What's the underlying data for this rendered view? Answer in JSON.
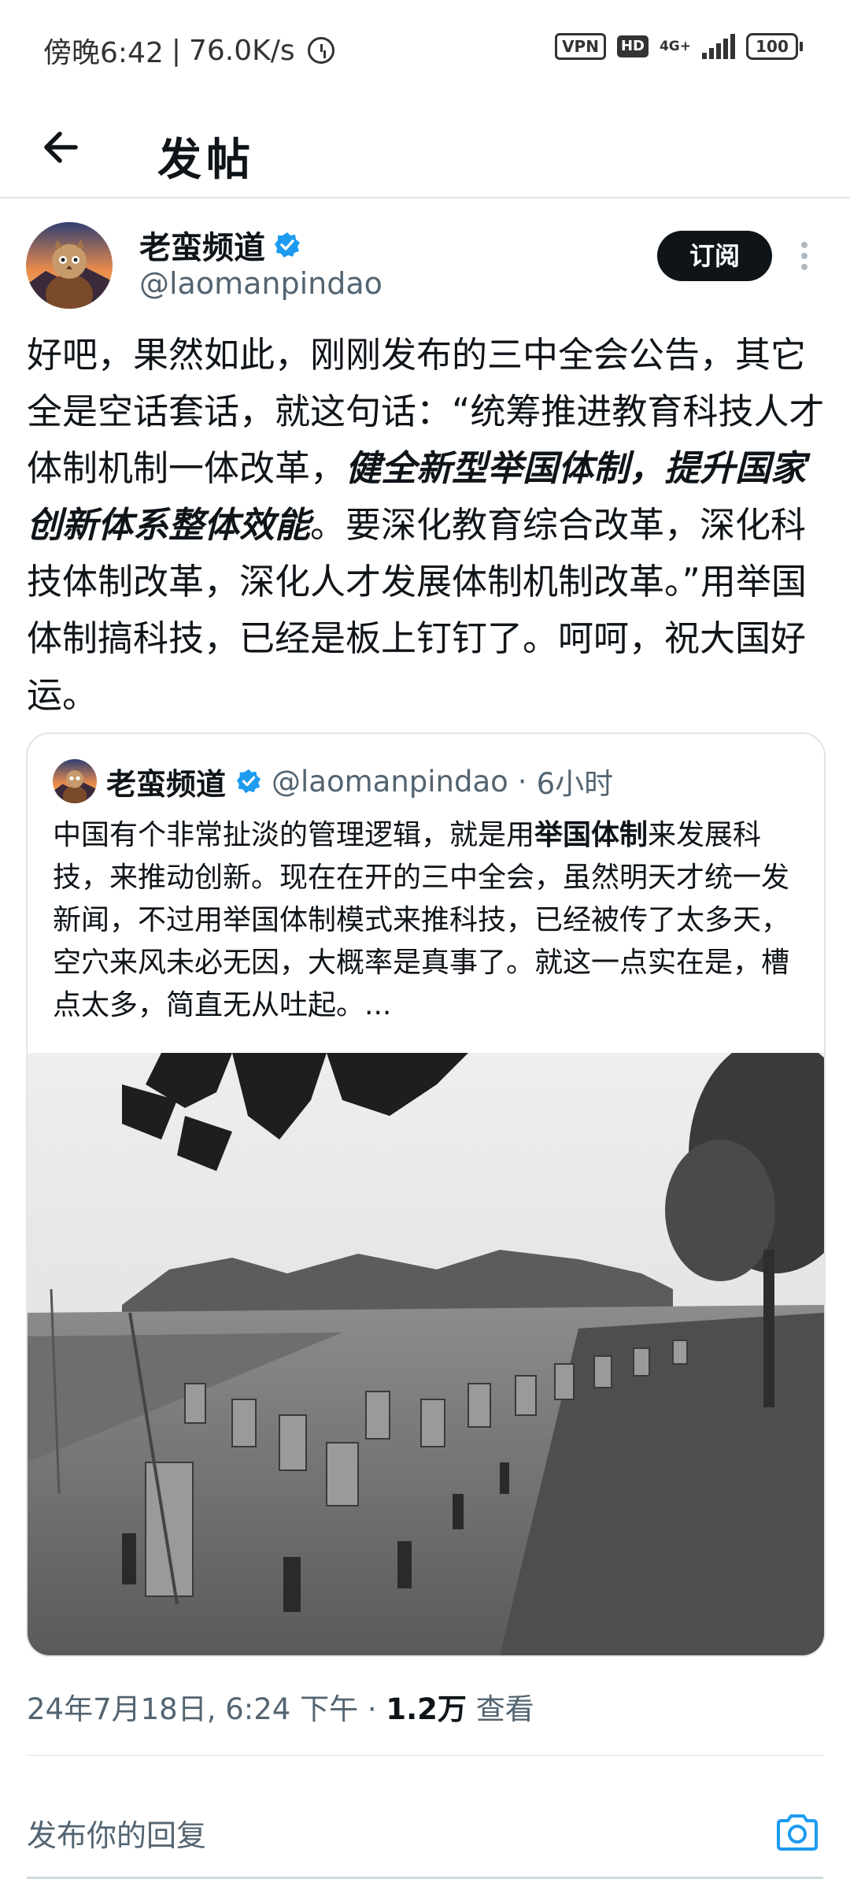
{
  "status_bar": {
    "time": "傍晚6:42",
    "speed": "76.0K/s",
    "vpn": "VPN",
    "hd": "HD",
    "network": "4G+",
    "battery": "100"
  },
  "header": {
    "title": "发帖"
  },
  "post": {
    "author_name": "老蛮频道",
    "author_handle": "@laomanpindao",
    "subscribe_label": "订阅",
    "text_1": "好吧，果然如此，刚刚发布的三中全会公告，其它全是空话套话，就这句话：“统筹推进教育科技人才体制机制一体改革，",
    "text_emph": "健全新型举国体制，提升国家创新体系整体效能",
    "text_2": "。要深化教育综合改革，深化科技体制改革，深化人才发展体制机制改革。”用举国体制搞科技，已经是板上钉钉了。呵呵，祝大国好运。",
    "timestamp": "24年7月18日, 6:24 下午",
    "views_count": "1.2万",
    "views_label": "查看"
  },
  "quote": {
    "author_name": "老蛮频道",
    "author_handle": "@laomanpindao",
    "time": "6小时",
    "text_1": "中国有个非常扯淡的管理逻辑，就是用",
    "text_bold": "举国体制",
    "text_2": "来发展科技，来推动创新。现在在开的三中全会，虽然明天才统一发新闻，不过用举国体制模式来推科技，已经被传了太多天，空穴来风未必无因，大概率是真事了。就这一点实在是，槽点太多，简直无从吐起。..."
  },
  "reply": {
    "placeholder": "发布你的回复"
  },
  "colors": {
    "verified": "#1d9bf0",
    "text_primary": "#0f1419",
    "text_secondary": "#536471",
    "camera": "#1d9bf0"
  },
  "icons": [
    "back-arrow-icon",
    "verified-icon",
    "more-icon",
    "camera-icon",
    "alarm-icon",
    "signal-icon",
    "battery-icon"
  ]
}
